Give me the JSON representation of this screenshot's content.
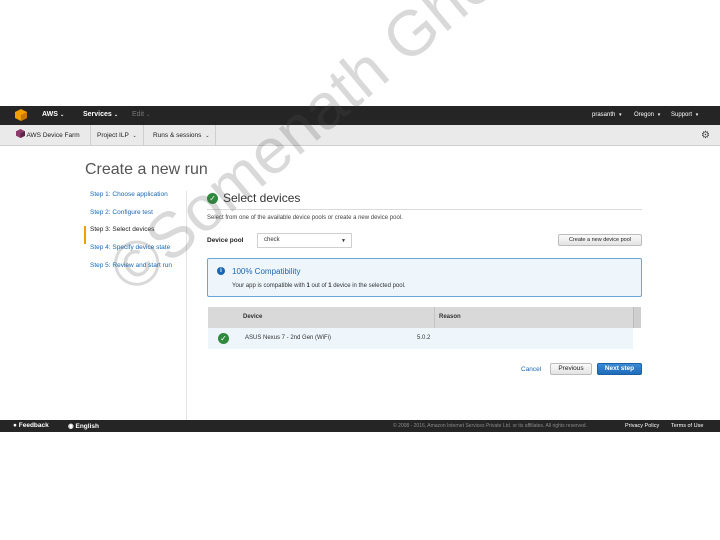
{
  "topnav": {
    "brand": "AWS",
    "services": "Services",
    "edit": "Edit",
    "user": "prasanth",
    "region": "Oregon",
    "support": "Support"
  },
  "subnav": {
    "app": "AWS Device Farm",
    "project": "Project ILP",
    "runs": "Runs & sessions"
  },
  "page_title": "Create a new run",
  "steps": [
    "Step 1: Choose application",
    "Step 2: Configure test",
    "Step 3: Select devices",
    "Step 4: Specify device state",
    "Step 5: Review and start run"
  ],
  "section": {
    "title": "Select devices",
    "intro": "Select from one of the available device pools or create a new device pool."
  },
  "device_pool": {
    "label": "Device pool",
    "value": "check",
    "create_button": "Create a new device pool"
  },
  "compat": {
    "title": "100% Compatibility",
    "msg_prefix": "Your app is compatible with ",
    "count": "1",
    "msg_middle": " out of ",
    "total": "1",
    "msg_suffix": " device in the selected pool."
  },
  "table": {
    "headers": [
      "Device",
      "Reason"
    ],
    "rows": [
      {
        "device": "ASUS Nexus 7 - 2nd Gen (WiFi)",
        "version": "5.0.2"
      }
    ]
  },
  "actions": {
    "cancel": "Cancel",
    "previous": "Previous",
    "next": "Next step"
  },
  "footer": {
    "feedback": "Feedback",
    "language": "English",
    "copyright": "© 2008 - 2016, Amazon Internet Services Private Ltd. or its affiliates. All rights reserved.",
    "privacy": "Privacy Policy",
    "terms": "Terms of Use"
  },
  "watermark": "©Somenath Ghosh",
  "colors": {
    "accent": "#1a67b3",
    "success": "#2e8b3d",
    "active_step": "#f29d00",
    "nav_bg": "#252525"
  }
}
